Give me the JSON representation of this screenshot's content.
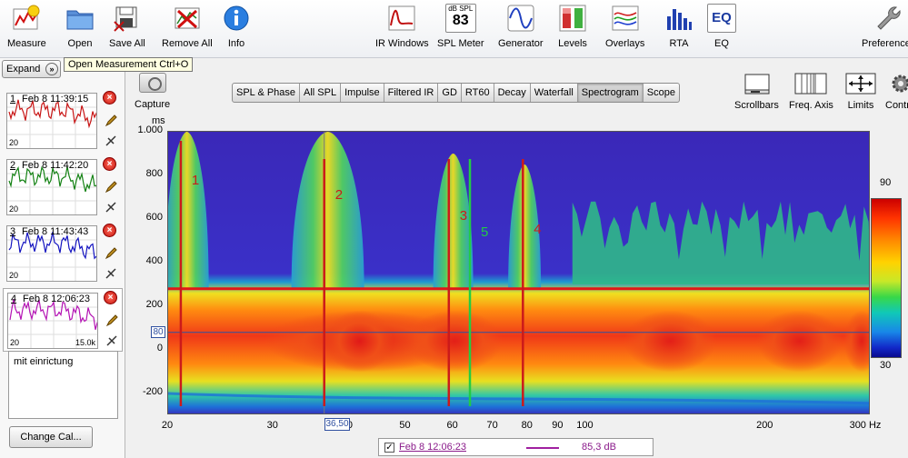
{
  "toolbar": {
    "left": [
      {
        "label": "Measure",
        "icon": "measure-icon"
      },
      {
        "label": "Open",
        "icon": "folder-icon"
      },
      {
        "label": "Save All",
        "icon": "save-all-icon"
      },
      {
        "label": "Remove All",
        "icon": "remove-all-icon"
      },
      {
        "label": "Info",
        "icon": "info-icon"
      }
    ],
    "center": [
      {
        "label": "IR Windows",
        "icon": "ir-windows-icon"
      },
      {
        "label": "SPL Meter",
        "icon": "spl-meter-icon",
        "display_top": "dB SPL",
        "display_value": "83"
      },
      {
        "label": "Generator",
        "icon": "sine-wave-icon"
      },
      {
        "label": "Levels",
        "icon": "levels-icon"
      },
      {
        "label": "Overlays",
        "icon": "overlays-icon"
      },
      {
        "label": "RTA",
        "icon": "rta-icon"
      },
      {
        "label": "EQ",
        "icon": "eq-icon",
        "text": "EQ"
      }
    ],
    "right": {
      "label": "Preferences",
      "icon": "wrench-icon"
    }
  },
  "tooltip": "Open Measurement  Ctrl+O",
  "sidebar": {
    "expand_label": "Expand",
    "expand_icon_text": "»",
    "measurements": [
      {
        "num": "1",
        "date": "Feb 8 11:39:15",
        "color": "#c81414",
        "selected": false
      },
      {
        "num": "2",
        "date": "Feb 8 11:42:20",
        "color": "#148214",
        "selected": false
      },
      {
        "num": "3",
        "date": "Feb 8 11:43:43",
        "color": "#1414c0",
        "selected": false
      },
      {
        "num": "4",
        "date": "Feb 8 12:06:23",
        "color": "#b414b4",
        "selected": true
      }
    ],
    "thumb_label": "20",
    "thumb_label_selected": "15.0k",
    "notes": "mit einrictung",
    "change_cal_label": "Change Cal..."
  },
  "capture_label": "Capture",
  "tabs": [
    {
      "label": "SPL & Phase",
      "active": false
    },
    {
      "label": "All SPL",
      "active": false
    },
    {
      "label": "Impulse",
      "active": false
    },
    {
      "label": "Filtered IR",
      "active": false
    },
    {
      "label": "GD",
      "active": false
    },
    {
      "label": "RT60",
      "active": false
    },
    {
      "label": "Decay",
      "active": false
    },
    {
      "label": "Waterfall",
      "active": false
    },
    {
      "label": "Spectrogram",
      "active": true
    },
    {
      "label": "Scope",
      "active": false
    }
  ],
  "right_tools": [
    {
      "label": "Scrollbars",
      "icon": "scrollbars-icon"
    },
    {
      "label": "Freq. Axis",
      "icon": "freq-axis-icon"
    },
    {
      "label": "Limits",
      "icon": "limits-icon"
    },
    {
      "label": "Contr",
      "icon": "controls-gear-icon"
    }
  ],
  "chart_data": {
    "type": "heatmap",
    "ylabel": "ms",
    "xlabel": "Hz",
    "x_scale": "log",
    "xlim": [
      20,
      300
    ],
    "ylim": [
      -300,
      1000
    ],
    "y_ticks": [
      "1.000",
      "800",
      "600",
      "400",
      "200",
      "0",
      "-200"
    ],
    "x_ticks": [
      "20",
      "30",
      "40",
      "50",
      "60",
      "70",
      "80",
      "90",
      "100",
      "200",
      "300 Hz"
    ],
    "cursor_x": "36,50",
    "cursor_y": "80",
    "colorscale": {
      "max": "90",
      "min": "30"
    },
    "annotations": [
      {
        "text": "1",
        "color": "#cc1a1a",
        "freq": 21
      },
      {
        "text": "2",
        "color": "#cc1a1a",
        "freq": 36.5
      },
      {
        "text": "3",
        "color": "#cc1a1a",
        "freq": 59
      },
      {
        "text": "5",
        "color": "#22cc44",
        "freq": 64
      },
      {
        "text": "4",
        "color": "#cc1a1a",
        "freq": 78.5
      }
    ],
    "horizontal_marker_ms": 280
  },
  "legend": {
    "checked": true,
    "name": "Feb 8 12:06:23",
    "value": "85,3 dB",
    "color": "#a020a0"
  }
}
